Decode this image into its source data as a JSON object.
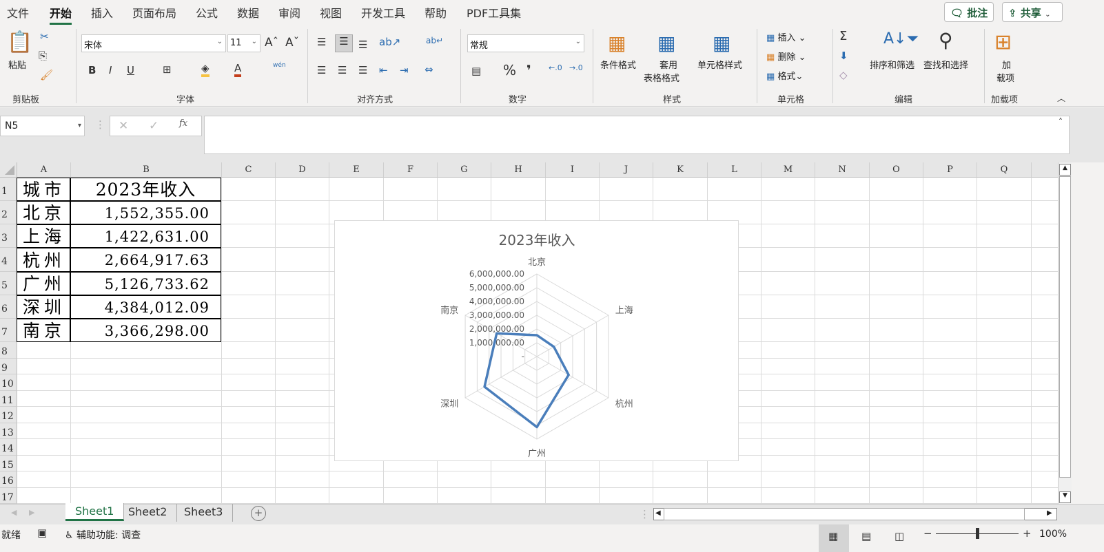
{
  "menu_tabs": [
    "文件",
    "开始",
    "插入",
    "页面布局",
    "公式",
    "数据",
    "审阅",
    "视图",
    "开发工具",
    "帮助",
    "PDF工具集"
  ],
  "active_tab": "开始",
  "top_buttons": {
    "comment": "批注",
    "share": "共享"
  },
  "ribbon": {
    "clipboard": {
      "paste": "粘贴",
      "group": "剪贴板"
    },
    "font": {
      "name": "宋体",
      "size": "11",
      "bold": "B",
      "italic": "I",
      "underline": "U",
      "group": "字体",
      "fill_color": "#f7c342",
      "font_color": "#c43e1c",
      "phonetic": "wén"
    },
    "alignment": {
      "group": "对齐方式"
    },
    "number": {
      "format": "常规",
      "percent": "%",
      "comma": "❜",
      "group": "数字"
    },
    "styles": {
      "conditional": "条件格式",
      "table1": "套用",
      "table2": "表格格式",
      "cell_styles": "单元格样式",
      "group": "样式"
    },
    "cells": {
      "insert": "插入",
      "delete": "删除",
      "format": "格式",
      "group": "单元格"
    },
    "editing": {
      "sort": "排序和筛选",
      "find": "查找和选择",
      "group": "编辑"
    },
    "addins": {
      "label1": "加",
      "label2": "载项",
      "group": "加载项"
    }
  },
  "formula_bar": {
    "name_box": "N5",
    "fx": "fx",
    "value": ""
  },
  "columns": [
    "A",
    "B",
    "C",
    "D",
    "E",
    "F",
    "G",
    "H",
    "I",
    "J",
    "K",
    "L",
    "M",
    "N",
    "O",
    "P",
    "Q"
  ],
  "rows": [
    "1",
    "2",
    "3",
    "4",
    "5",
    "6",
    "7",
    "8",
    "9",
    "10",
    "11",
    "12",
    "13",
    "14",
    "15",
    "16",
    "17"
  ],
  "table": {
    "header": [
      "城市",
      "2023年收入"
    ],
    "rows": [
      [
        "北京",
        "1,552,355.00"
      ],
      [
        "上海",
        "1,422,631.00"
      ],
      [
        "杭州",
        "2,664,917.63"
      ],
      [
        "广州",
        "5,126,733.62"
      ],
      [
        "深圳",
        "4,384,012.09"
      ],
      [
        "南京",
        "3,366,298.00"
      ]
    ]
  },
  "chart_data": {
    "type": "radar",
    "title": "2023年收入",
    "categories": [
      "北京",
      "上海",
      "杭州",
      "广州",
      "深圳",
      "南京"
    ],
    "values": [
      1552355.0,
      1422631.0,
      2664917.63,
      5126733.62,
      4384012.09,
      3366298.0
    ],
    "axis_ticks": [
      "-",
      "1,000,000.00",
      "2,000,000.00",
      "3,000,000.00",
      "4,000,000.00",
      "5,000,000.00",
      "6,000,000.00"
    ],
    "range": [
      0,
      6000000
    ],
    "line_color": "#4a7ebb",
    "grid": true
  },
  "sheets": [
    "Sheet1",
    "Sheet2",
    "Sheet3"
  ],
  "active_sheet": "Sheet1",
  "status": {
    "ready": "就绪",
    "accessibility": "辅助功能: 调查",
    "zoom": "100%",
    "zoom_level": 100
  }
}
